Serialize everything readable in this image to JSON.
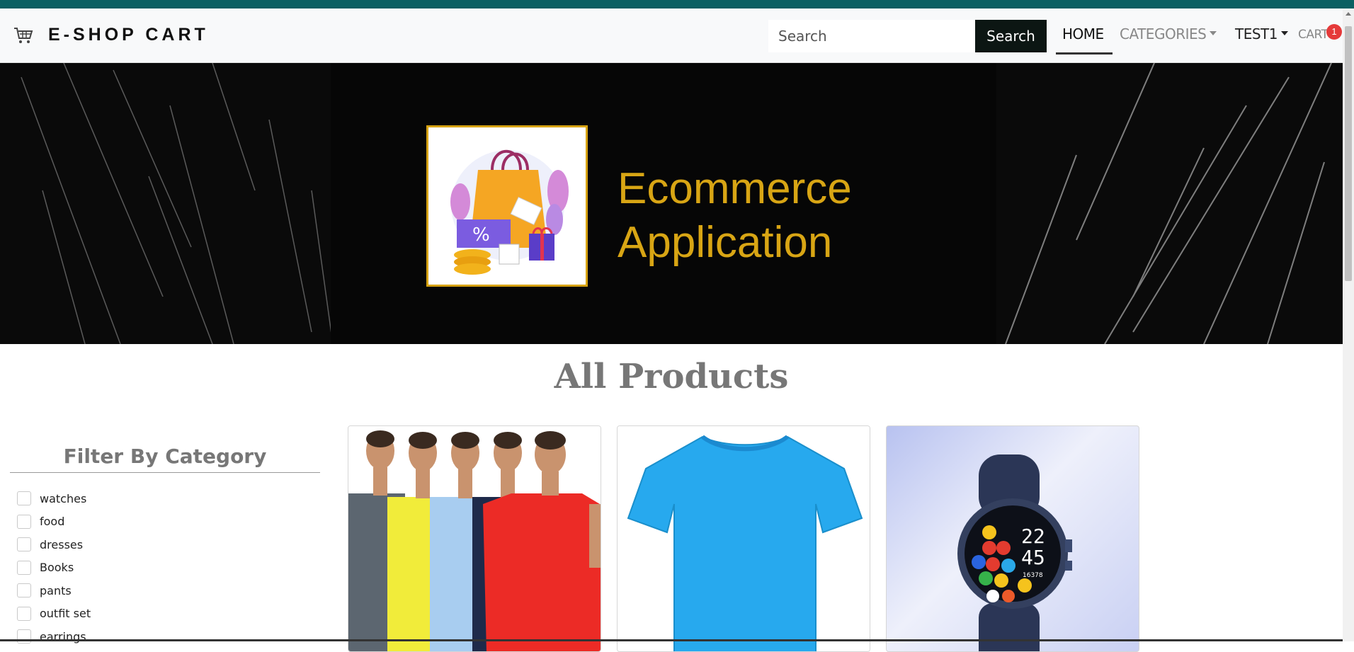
{
  "navbar": {
    "brand": "E-SHOP CART",
    "search_placeholder": "Search",
    "search_button": "Search",
    "links": {
      "home": "HOME",
      "categories": "CATEGORIES",
      "user": "TEST1",
      "cart": "CART"
    },
    "cart_count": "1"
  },
  "hero": {
    "title_line1": "Ecommerce",
    "title_line2": "Application"
  },
  "main": {
    "heading": "All Products"
  },
  "filter": {
    "title": "Filter By Category",
    "categories": [
      {
        "label": "watches",
        "checked": false
      },
      {
        "label": "food",
        "checked": false
      },
      {
        "label": "dresses",
        "checked": false
      },
      {
        "label": "Books",
        "checked": false
      },
      {
        "label": "pants",
        "checked": false
      },
      {
        "label": "outfit set",
        "checked": false
      },
      {
        "label": "earrings",
        "checked": false
      }
    ]
  },
  "products": [
    {
      "image": "group-of-men-tshirts"
    },
    {
      "image": "blue-tshirt"
    },
    {
      "image": "smartwatch"
    }
  ],
  "icons": {
    "brand": "shopping-cart-icon",
    "dropdown": "caret-down-icon"
  },
  "colors": {
    "top_strip": "#0b6063",
    "search_button_bg": "#0c1613",
    "badge": "#e53a3a",
    "hero_text": "#d8a514"
  }
}
